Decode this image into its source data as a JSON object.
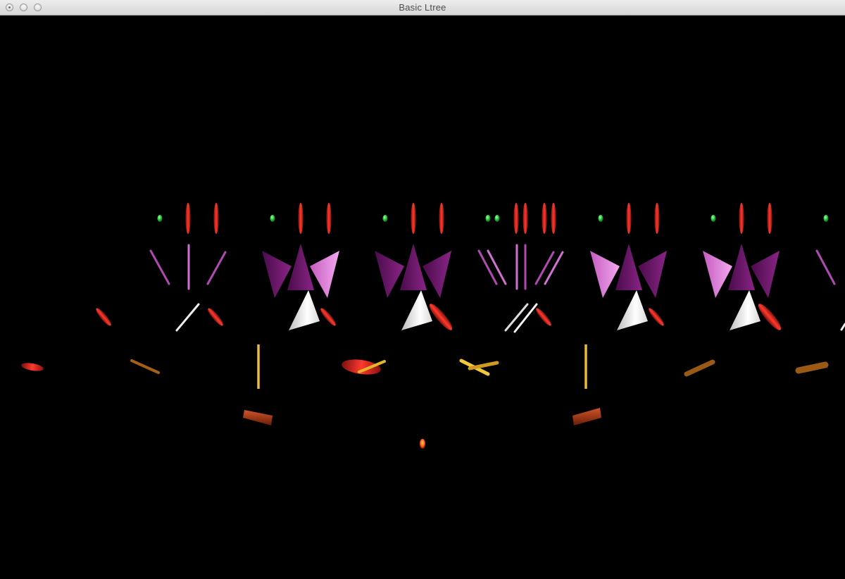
{
  "window": {
    "title": "Basic Ltree",
    "controls": [
      "close",
      "minimize",
      "zoom"
    ]
  },
  "scene": {
    "background": "#000000",
    "description_colors": {
      "leaf_red": "#d32a22",
      "bud_green": "#22c83a",
      "cone_purple": "#7d1f7a",
      "cone_light": "#e48be0",
      "branch_white": "#f2f2f2",
      "trunk_gold": "#e0b028",
      "trunk_brown": "#8a4a18",
      "base_rust": "#a83a1c",
      "ember_orange": "#ff6a1a"
    }
  }
}
